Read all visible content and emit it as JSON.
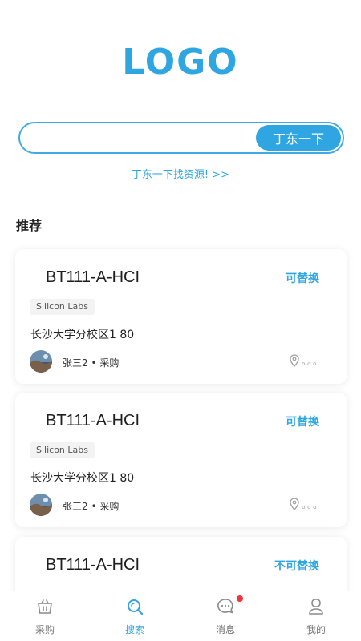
{
  "logo": {
    "text": "LOGO",
    "color": "#2fa6e1"
  },
  "search": {
    "value": "",
    "placeholder": "",
    "button_label": "丁东一下"
  },
  "find_link": "丁东一下找资源! >>",
  "section_title": "推荐",
  "cards": [
    {
      "part_number": "BT111-A-HCI",
      "status": "可替换",
      "brand": "Silicon Labs",
      "address": "长沙大学分校区1 80",
      "user": "张三2 • 采购",
      "location_dots": "。。。"
    },
    {
      "part_number": "BT111-A-HCI",
      "status": "可替换",
      "brand": "Silicon Labs",
      "address": "长沙大学分校区1 80",
      "user": "张三2 • 采购",
      "location_dots": "。。。"
    },
    {
      "part_number": "BT111-A-HCI",
      "status": "不可替换",
      "brand": "",
      "address": "",
      "user": "",
      "location_dots": ""
    }
  ],
  "tabbar": {
    "tabs": [
      {
        "label": "采购",
        "icon": "basket-icon",
        "active": false
      },
      {
        "label": "搜索",
        "icon": "search-icon",
        "active": true
      },
      {
        "label": "消息",
        "icon": "message-icon",
        "active": false,
        "badge": true
      },
      {
        "label": "我的",
        "icon": "user-icon",
        "active": false
      }
    ]
  },
  "colors": {
    "accent": "#2fa6e1",
    "badge": "#f2323c",
    "text": "#222222"
  }
}
